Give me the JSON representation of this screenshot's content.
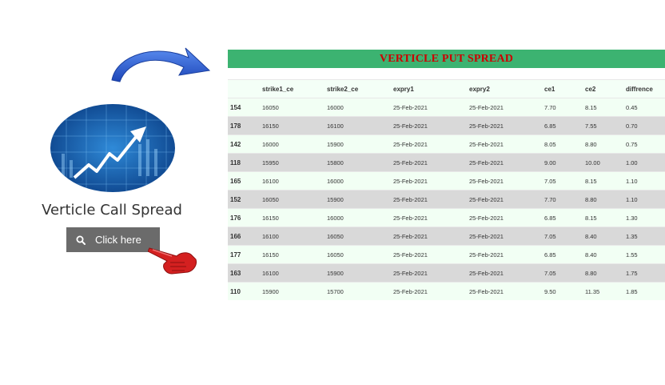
{
  "promo": {
    "title": "Verticle Call Spread",
    "button_label": "Click here"
  },
  "icons": [
    "arrow-curve-icon",
    "chart-logo-icon",
    "search-icon",
    "pointing-hand-icon"
  ],
  "colors": {
    "title_bar": "#3cb371",
    "title_text": "#cc0000",
    "button_bg": "#6b6b6b",
    "arrow": "#2f62d6",
    "hand": "#d42020"
  },
  "table": {
    "title": "VERTICLE PUT SPREAD",
    "headers": [
      "",
      "strike1_ce",
      "strike2_ce",
      "expry1",
      "expry2",
      "ce1",
      "ce2",
      "diffrence"
    ],
    "rows": [
      [
        "154",
        "16050",
        "16000",
        "25-Feb-2021",
        "25-Feb-2021",
        "7.70",
        "8.15",
        "0.45"
      ],
      [
        "178",
        "16150",
        "16100",
        "25-Feb-2021",
        "25-Feb-2021",
        "6.85",
        "7.55",
        "0.70"
      ],
      [
        "142",
        "16000",
        "15900",
        "25-Feb-2021",
        "25-Feb-2021",
        "8.05",
        "8.80",
        "0.75"
      ],
      [
        "118",
        "15950",
        "15800",
        "25-Feb-2021",
        "25-Feb-2021",
        "9.00",
        "10.00",
        "1.00"
      ],
      [
        "165",
        "16100",
        "16000",
        "25-Feb-2021",
        "25-Feb-2021",
        "7.05",
        "8.15",
        "1.10"
      ],
      [
        "152",
        "16050",
        "15900",
        "25-Feb-2021",
        "25-Feb-2021",
        "7.70",
        "8.80",
        "1.10"
      ],
      [
        "176",
        "16150",
        "16000",
        "25-Feb-2021",
        "25-Feb-2021",
        "6.85",
        "8.15",
        "1.30"
      ],
      [
        "166",
        "16100",
        "16050",
        "25-Feb-2021",
        "25-Feb-2021",
        "7.05",
        "8.40",
        "1.35"
      ],
      [
        "177",
        "16150",
        "16050",
        "25-Feb-2021",
        "25-Feb-2021",
        "6.85",
        "8.40",
        "1.55"
      ],
      [
        "163",
        "16100",
        "15900",
        "25-Feb-2021",
        "25-Feb-2021",
        "7.05",
        "8.80",
        "1.75"
      ],
      [
        "110",
        "15900",
        "15700",
        "25-Feb-2021",
        "25-Feb-2021",
        "9.50",
        "11.35",
        "1.85"
      ]
    ]
  }
}
